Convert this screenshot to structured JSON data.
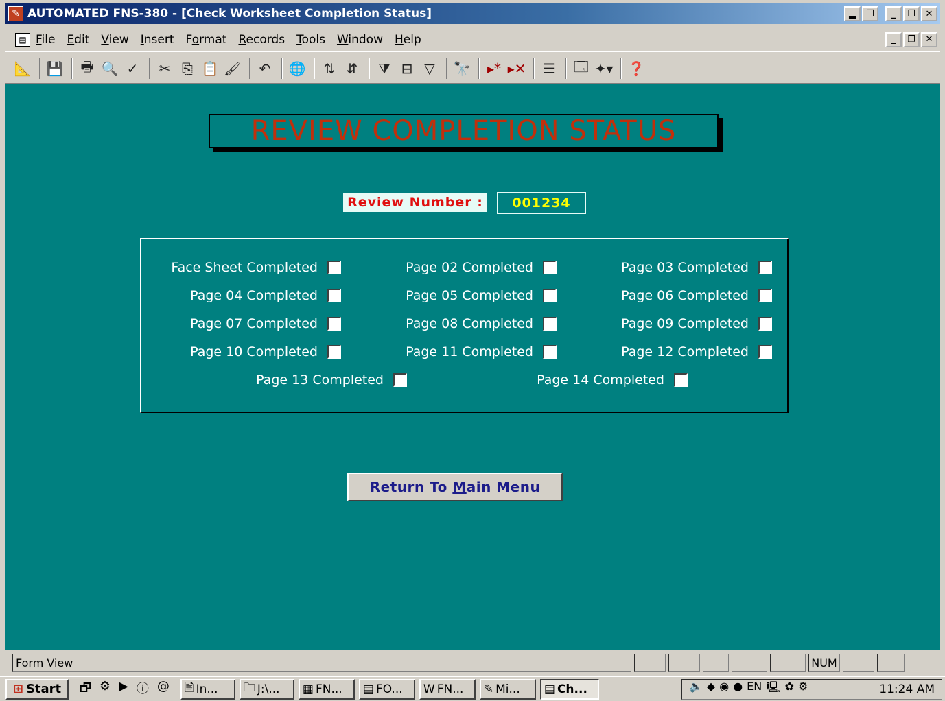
{
  "window": {
    "title": "AUTOMATED FNS-380 - [Check Worksheet Completion Status]"
  },
  "menu": [
    {
      "label": "File",
      "key": "F"
    },
    {
      "label": "Edit",
      "key": "E"
    },
    {
      "label": "View",
      "key": "V"
    },
    {
      "label": "Insert",
      "key": "I"
    },
    {
      "label": "Format",
      "key": "o"
    },
    {
      "label": "Records",
      "key": "R"
    },
    {
      "label": "Tools",
      "key": "T"
    },
    {
      "label": "Window",
      "key": "W"
    },
    {
      "label": "Help",
      "key": "H"
    }
  ],
  "toolbar": {
    "icons": [
      "design-view-icon",
      "save-icon",
      "print-icon",
      "print-preview-icon",
      "spelling-icon",
      "cut-icon",
      "copy-icon",
      "paste-icon",
      "format-painter-icon",
      "undo-icon",
      "hyperlink-icon",
      "sort-ascending-icon",
      "sort-descending-icon",
      "filter-by-selection-icon",
      "filter-by-form-icon",
      "apply-filter-icon",
      "find-icon",
      "new-record-icon",
      "delete-record-icon",
      "properties-icon",
      "database-window-icon",
      "new-object-icon",
      "help-icon"
    ]
  },
  "form": {
    "header": "REVIEW COMPLETION STATUS",
    "review_number_label": "Review Number :",
    "review_number_value": "001234",
    "checkboxes": [
      {
        "label": "Face Sheet Completed",
        "checked": false
      },
      {
        "label": "Page 02 Completed",
        "checked": false
      },
      {
        "label": "Page 03 Completed",
        "checked": false
      },
      {
        "label": "Page 04 Completed",
        "checked": false
      },
      {
        "label": "Page 05 Completed",
        "checked": false
      },
      {
        "label": "Page 06 Completed",
        "checked": false
      },
      {
        "label": "Page 07 Completed",
        "checked": false
      },
      {
        "label": "Page 08 Completed",
        "checked": false
      },
      {
        "label": "Page 09 Completed",
        "checked": false
      },
      {
        "label": "Page 10 Completed",
        "checked": false
      },
      {
        "label": "Page 11 Completed",
        "checked": false
      },
      {
        "label": "Page 12 Completed",
        "checked": false
      },
      {
        "label": "Page 13 Completed",
        "checked": false
      },
      {
        "label": "Page 14 Completed",
        "checked": false
      }
    ],
    "return_button_pre": "Return To ",
    "return_button_key": "M",
    "return_button_post": "ain Menu"
  },
  "statusbar": {
    "text": "Form View",
    "num": "NUM"
  },
  "taskbar": {
    "start": "Start",
    "tasks": [
      {
        "label": "In...",
        "active": false
      },
      {
        "label": "J:\\...",
        "active": false
      },
      {
        "label": "FN...",
        "active": false
      },
      {
        "label": "FO...",
        "active": false
      },
      {
        "label": "FN...",
        "active": false
      },
      {
        "label": "Mi...",
        "active": false
      },
      {
        "label": "Ch...",
        "active": true
      }
    ],
    "clock": "11:24 AM",
    "lang": "EN"
  },
  "colors": {
    "form_bg": "#008080",
    "header_text": "#c0300c",
    "review_value": "#ffff00",
    "review_label": "#e01010"
  }
}
